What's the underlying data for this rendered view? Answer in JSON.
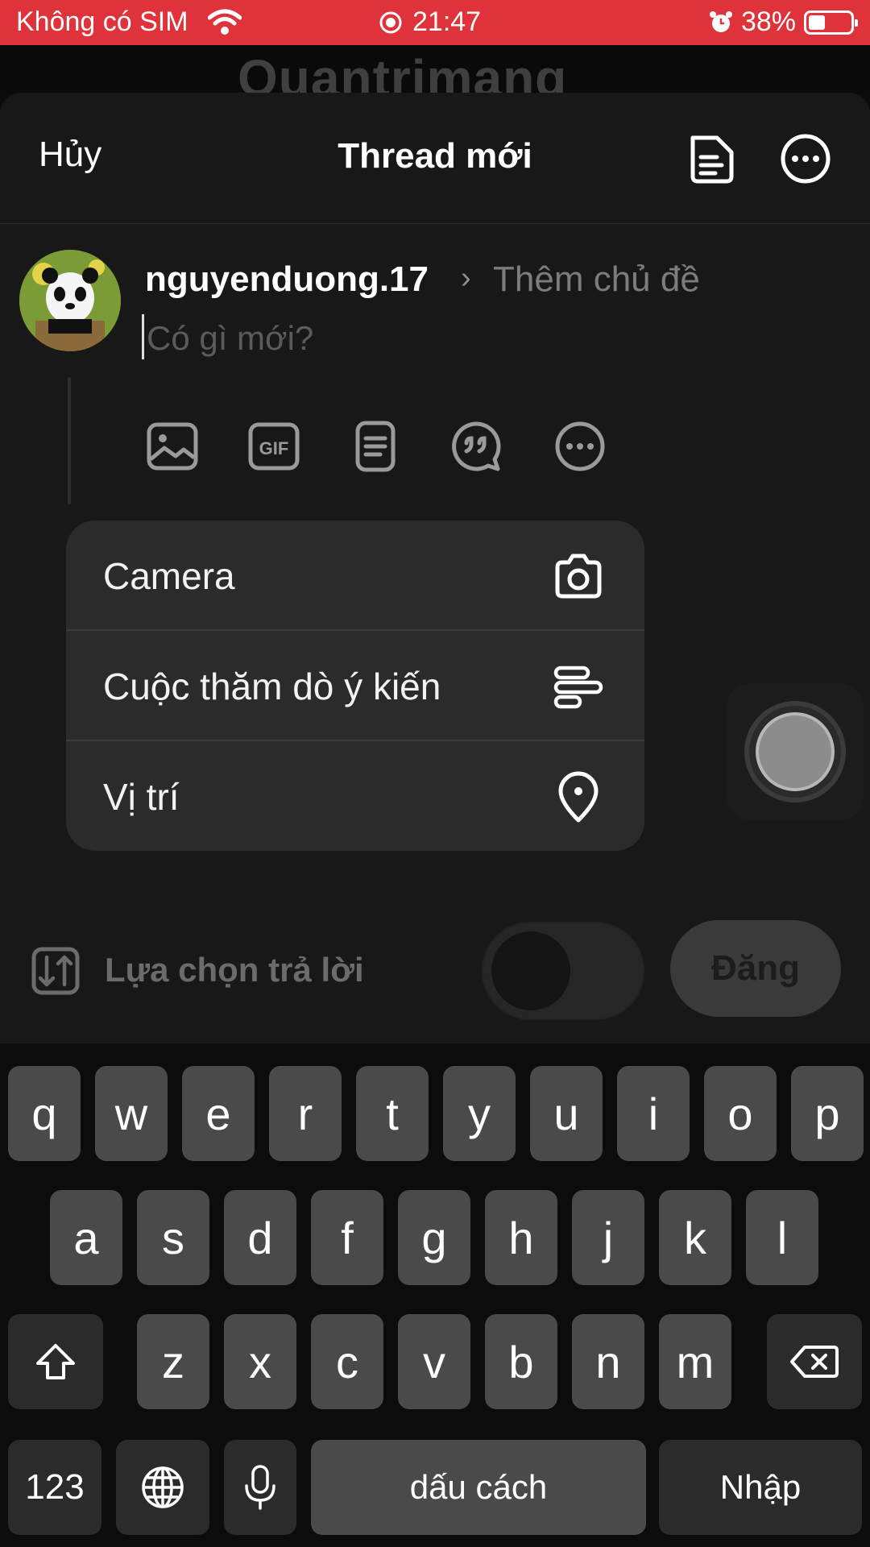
{
  "status_bar": {
    "carrier": "Không có SIM",
    "time": "21:47",
    "battery": "38%"
  },
  "watermark": "Quantrimang",
  "header": {
    "cancel_label": "Hủy",
    "title": "Thread mới"
  },
  "composer": {
    "username": "nguyenduong.17",
    "add_topic": "Thêm chủ đề",
    "placeholder": "Có gì mới?",
    "tools": [
      "image-icon",
      "gif-icon",
      "document-icon",
      "quote-icon",
      "more-icon"
    ],
    "gif_label": "GIF"
  },
  "menu": {
    "items": [
      {
        "label": "Camera",
        "icon": "camera-icon"
      },
      {
        "label": "Cuộc thăm dò ý kiến",
        "icon": "poll-icon"
      },
      {
        "label": "Vị trí",
        "icon": "location-pin-icon"
      }
    ]
  },
  "footer": {
    "reply_options": "Lựa chọn trả lời",
    "post_label": "Đăng"
  },
  "keyboard": {
    "row1": [
      "q",
      "w",
      "e",
      "r",
      "t",
      "y",
      "u",
      "i",
      "o",
      "p"
    ],
    "row2": [
      "a",
      "s",
      "d",
      "f",
      "g",
      "h",
      "j",
      "k",
      "l"
    ],
    "row3": [
      "z",
      "x",
      "c",
      "v",
      "b",
      "n",
      "m"
    ],
    "numbers": "123",
    "space": "dấu cách",
    "return": "Nhập"
  },
  "colors": {
    "status_bar": "#e0323a",
    "sheet": "#181818",
    "menu": "#2b2b2b",
    "key": "#4a4a4a"
  }
}
